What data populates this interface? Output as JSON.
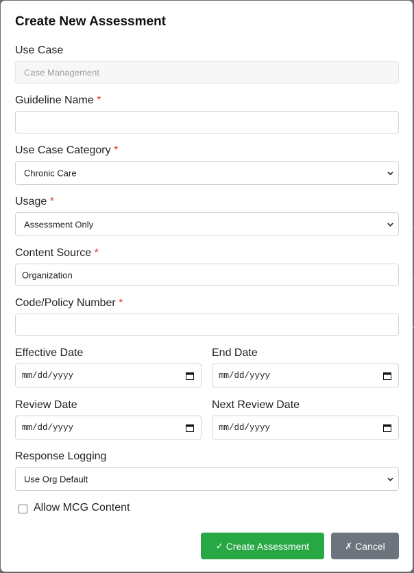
{
  "modal": {
    "title": "Create New Assessment"
  },
  "form": {
    "use_case": {
      "label": "Use Case",
      "value": "Case Management"
    },
    "guideline_name": {
      "label": "Guideline Name",
      "required_mark": "*",
      "value": ""
    },
    "use_case_category": {
      "label": "Use Case Category",
      "required_mark": "*",
      "selected": "Chronic Care"
    },
    "usage": {
      "label": "Usage",
      "required_mark": "*",
      "selected": "Assessment Only"
    },
    "content_source": {
      "label": "Content Source",
      "required_mark": "*",
      "value": "Organization"
    },
    "code_policy_number": {
      "label": "Code/Policy Number",
      "required_mark": "*",
      "value": ""
    },
    "effective_date": {
      "label": "Effective Date",
      "placeholder": "mm/dd/yyyy"
    },
    "end_date": {
      "label": "End Date",
      "placeholder": "mm/dd/yyyy"
    },
    "review_date": {
      "label": "Review Date",
      "placeholder": "mm/dd/yyyy"
    },
    "next_review_date": {
      "label": "Next Review Date",
      "placeholder": "mm/dd/yyyy"
    },
    "response_logging": {
      "label": "Response Logging",
      "selected": "Use Org Default"
    },
    "allow_mcg": {
      "label": "Allow MCG Content",
      "checked": false
    }
  },
  "actions": {
    "create_label": "Create Assessment",
    "create_icon": "checkmark-icon",
    "cancel_label": "Cancel",
    "cancel_icon": "x-icon"
  },
  "colors": {
    "primary": "#28a745",
    "secondary": "#6c757d",
    "required": "#e53935"
  }
}
